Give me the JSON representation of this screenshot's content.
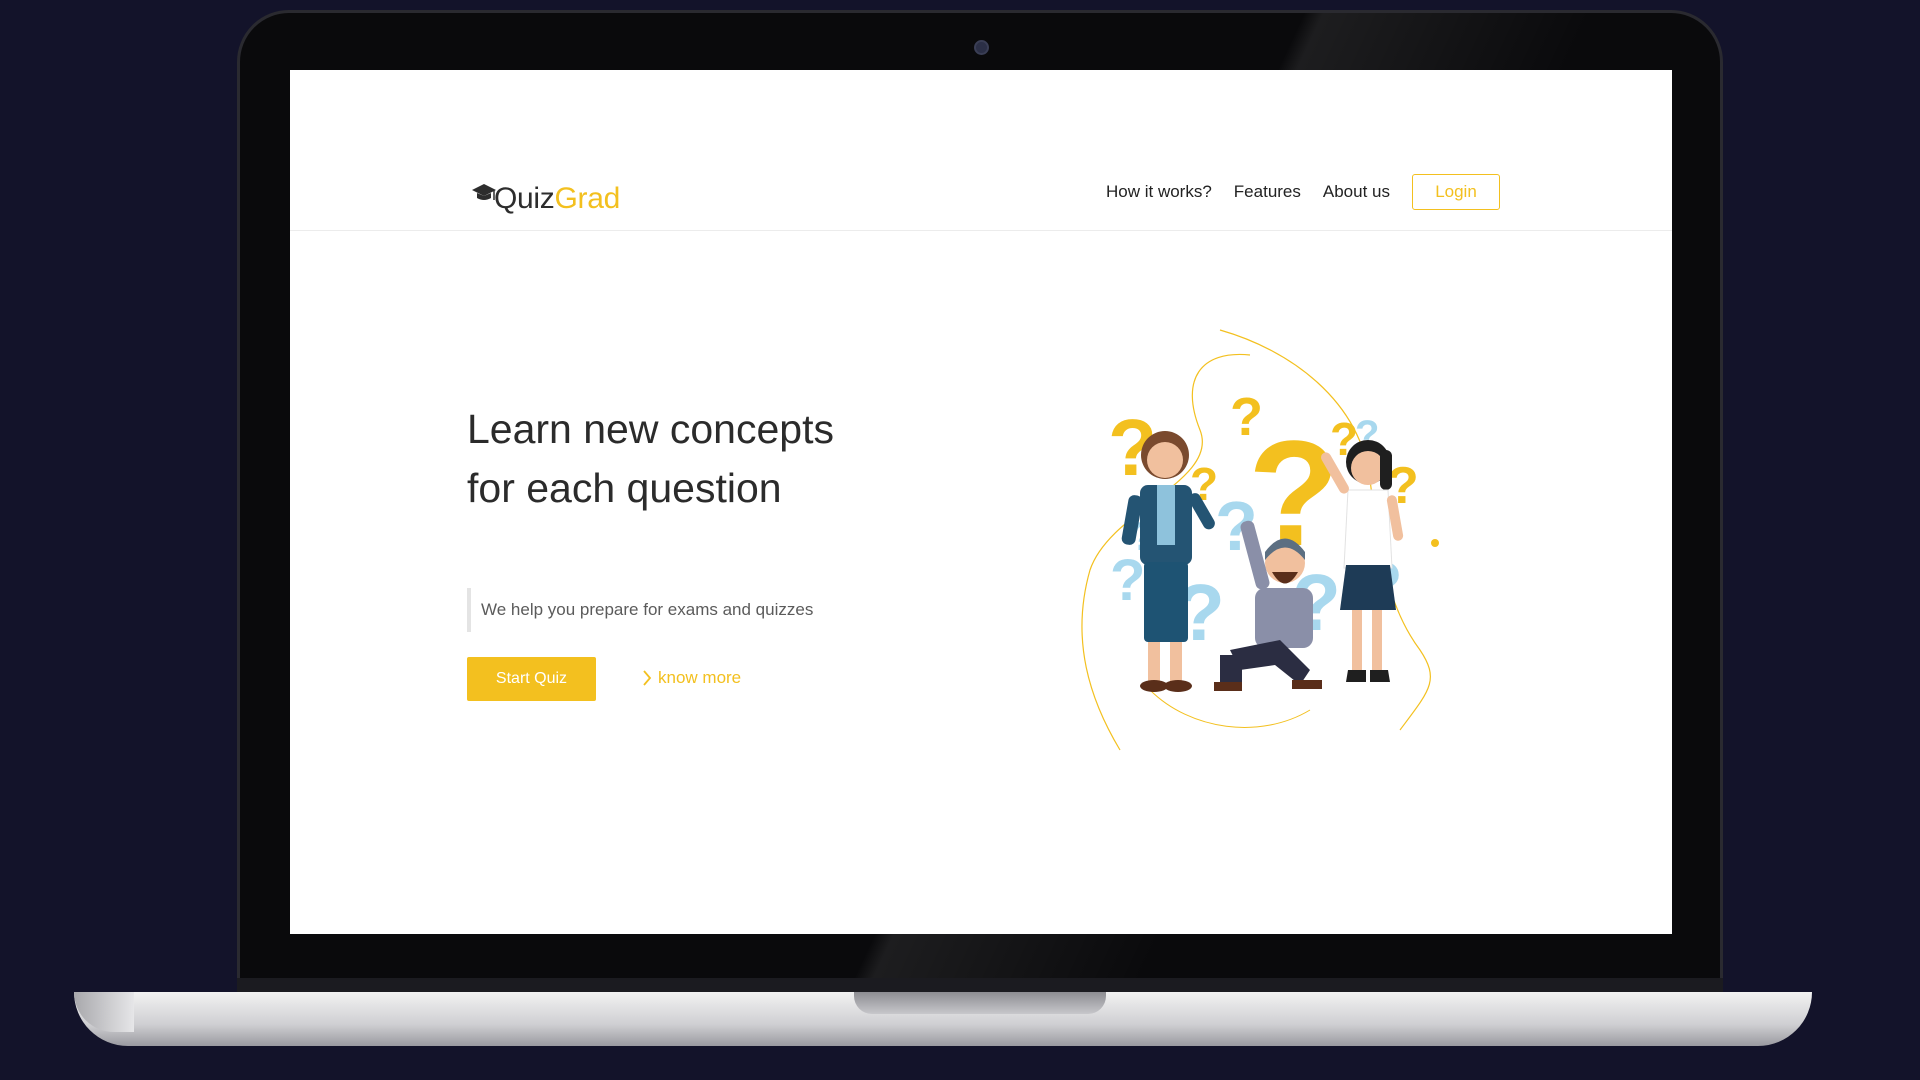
{
  "brand": {
    "logo_part1": "Quiz",
    "logo_part2": "Grad",
    "accent": "#f3c01f"
  },
  "nav": {
    "items": [
      "How it works?",
      "Features",
      "About us"
    ],
    "login_label": "Login"
  },
  "hero": {
    "title": "Learn new concepts for each question",
    "subtitle": "We help you prepare for exams and quizzes",
    "primary_cta": "Start Quiz",
    "secondary_cta": "know more"
  },
  "icons": {
    "logo": "graduation-cap-icon",
    "secondary_cta": "chevron-right-icon",
    "illustration": "people-with-question-marks"
  },
  "colors": {
    "background": "#13132a",
    "page": "#ffffff",
    "text": "#2b2b2b",
    "light_blue": "#a8d8ee"
  }
}
